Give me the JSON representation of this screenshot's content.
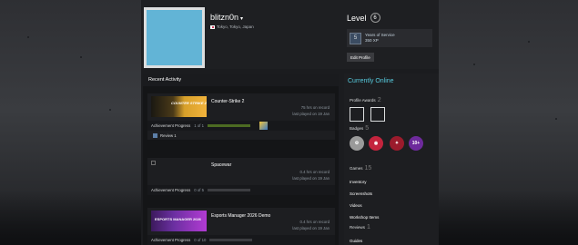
{
  "profile": {
    "username": "blitzn0n",
    "location": "Tokyo, Tokyo, Japan",
    "level_label": "Level",
    "level": "6",
    "service_badge": {
      "line1": "Years of Service",
      "line2": "350 XP"
    },
    "edit_button": "Edit Profile"
  },
  "recent_activity": {
    "title": "Recent Activity",
    "games": [
      {
        "name": "Counter-Strike 2",
        "capsule_text": "COUNTER STRIKE 2",
        "hours": "75 hrs on record",
        "last_played": "last played on 19 Jan",
        "ach_label": "Achievement Progress",
        "ach_count": "1 of 1",
        "ach_progress": 1.0,
        "latest_achievement": "Review 1"
      },
      {
        "name": "Spacewar",
        "hours": "0.4 hrs on record",
        "last_played": "last played on 19 Jan",
        "ach_label": "Achievement Progress",
        "ach_count": "0 of 5",
        "ach_progress": 0
      },
      {
        "name": "Esports Manager 2026 Demo",
        "capsule_text": "ESPORTS MANAGER 2026",
        "hours": "0.4 hrs on record",
        "last_played": "last played on 19 Jan",
        "ach_label": "Achievement Progress",
        "ach_count": "0 of 10",
        "ach_progress": 0
      }
    ]
  },
  "sidebar": {
    "status": "Currently Online",
    "awards_label": "Profile Awards",
    "awards_count": "2",
    "badges_label": "Badges",
    "badges_count": "5",
    "badge_4_text": "10+",
    "games_label": "Games",
    "games_count": "15",
    "links": [
      "Inventory",
      "Screenshots",
      "Videos",
      "Workshop Items"
    ],
    "reviews_label": "Reviews",
    "reviews_count": "1",
    "guides_label": "Guides"
  },
  "colors": {
    "online": "#57cbde",
    "avatar": "#62b4d6",
    "progress": "#4c6b22"
  }
}
